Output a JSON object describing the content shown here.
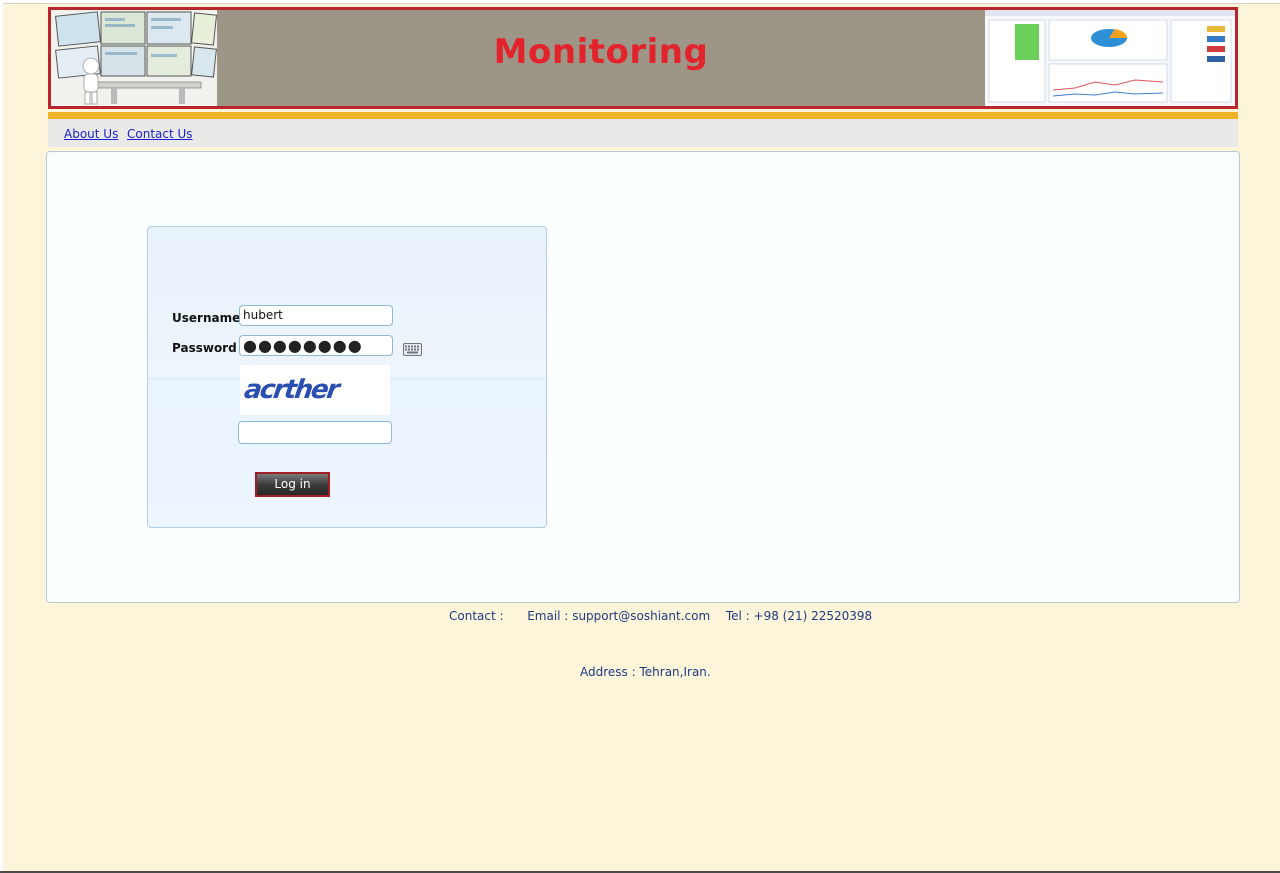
{
  "header": {
    "title": "Monitoring",
    "left_image_icon": "operator-monitors-illustration",
    "right_image_icon": "dashboard-screenshot-thumbnail",
    "colors": {
      "title": "#e3232c",
      "border": "#b8252b",
      "background": "#9d9585"
    }
  },
  "nav": {
    "items": [
      {
        "label": "About Us"
      },
      {
        "label": "Contact Us"
      }
    ]
  },
  "login": {
    "username_label": "Username",
    "username_value": "hubert",
    "password_label": "Password",
    "password_mask": "●●●●●●●●",
    "keyboard_icon": "virtual-keyboard-icon",
    "captcha_text": "acrther",
    "captcha_value": "",
    "login_button": "Log in"
  },
  "footer": {
    "contact_label": "Contact :",
    "email_label": "Email :",
    "email": "support@soshiant.com",
    "tel_label": "Tel :",
    "tel": "+98 (21) 22520398",
    "address_label": "Address :",
    "address": "Tehran,Iran."
  },
  "colors": {
    "page_background": "#fdf5da",
    "accent_bar": "#f0b327",
    "link": "#1a21c8",
    "footer_text": "#1f3a84"
  }
}
